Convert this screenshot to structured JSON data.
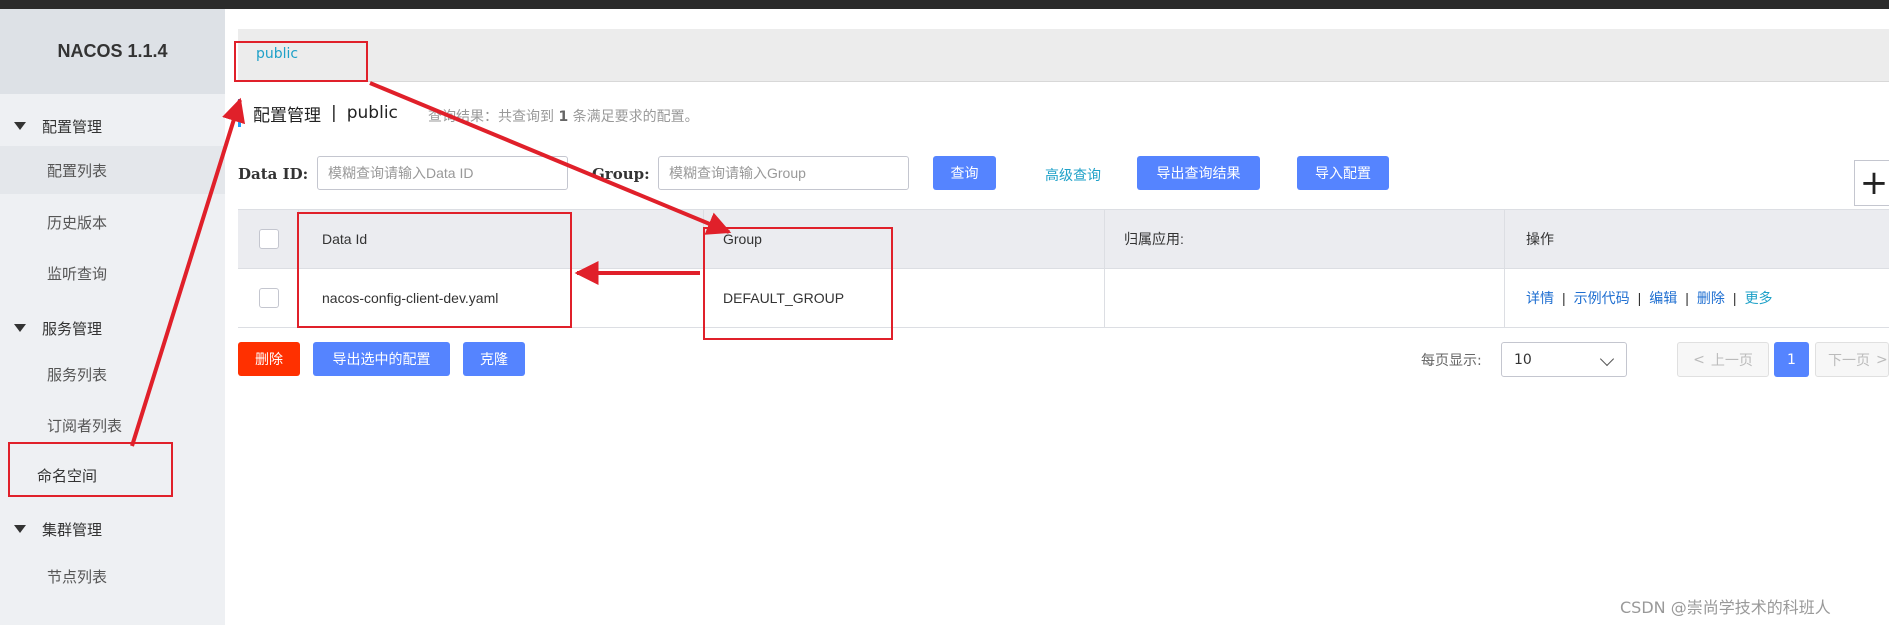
{
  "sidebar": {
    "brand": "NACOS 1.1.4",
    "groups": [
      {
        "label": "配置管理",
        "items": [
          "配置列表",
          "历史版本",
          "监听查询"
        ]
      },
      {
        "label": "服务管理",
        "items": [
          "服务列表",
          "订阅者列表"
        ]
      },
      {
        "label": "命名空间"
      },
      {
        "label": "集群管理",
        "items": [
          "节点列表"
        ]
      }
    ]
  },
  "breadcrumb": {
    "namespace_tab": "public"
  },
  "header": {
    "title": "配置管理",
    "separator": "|",
    "namespace": "public",
    "summary_prefix": "查询结果：共查询到",
    "summary_count": "1",
    "summary_suffix": "条满足要求的配置。"
  },
  "filters": {
    "dataid_label": "Data ID:",
    "dataid_placeholder": "模糊查询请输入Data ID",
    "group_label": "Group:",
    "group_placeholder": "模糊查询请输入Group",
    "query_button": "查询",
    "advanced_query": "高级查询",
    "export_results": "导出查询结果",
    "import_config": "导入配置",
    "add_icon": "+"
  },
  "table": {
    "columns": [
      "Data Id",
      "Group",
      "归属应用:",
      "操作"
    ],
    "rows": [
      {
        "data_id": "nacos-config-client-dev.yaml",
        "group": "DEFAULT_GROUP",
        "app": "",
        "actions": [
          "详情",
          "示例代码",
          "编辑",
          "删除",
          "更多"
        ]
      }
    ]
  },
  "bottom": {
    "delete": "删除",
    "export_selected": "导出选中的配置",
    "clone": "克隆",
    "page_size_label": "每页显示:",
    "page_size": "10",
    "prev": "上一页",
    "current_page": "1",
    "next": "下一页"
  },
  "watermark": "CSDN @崇尚学技术的科班人",
  "colors": {
    "primary": "#5584ff",
    "danger": "#ff3000",
    "link": "#1fa1c8",
    "annotation": "#e0202a"
  }
}
